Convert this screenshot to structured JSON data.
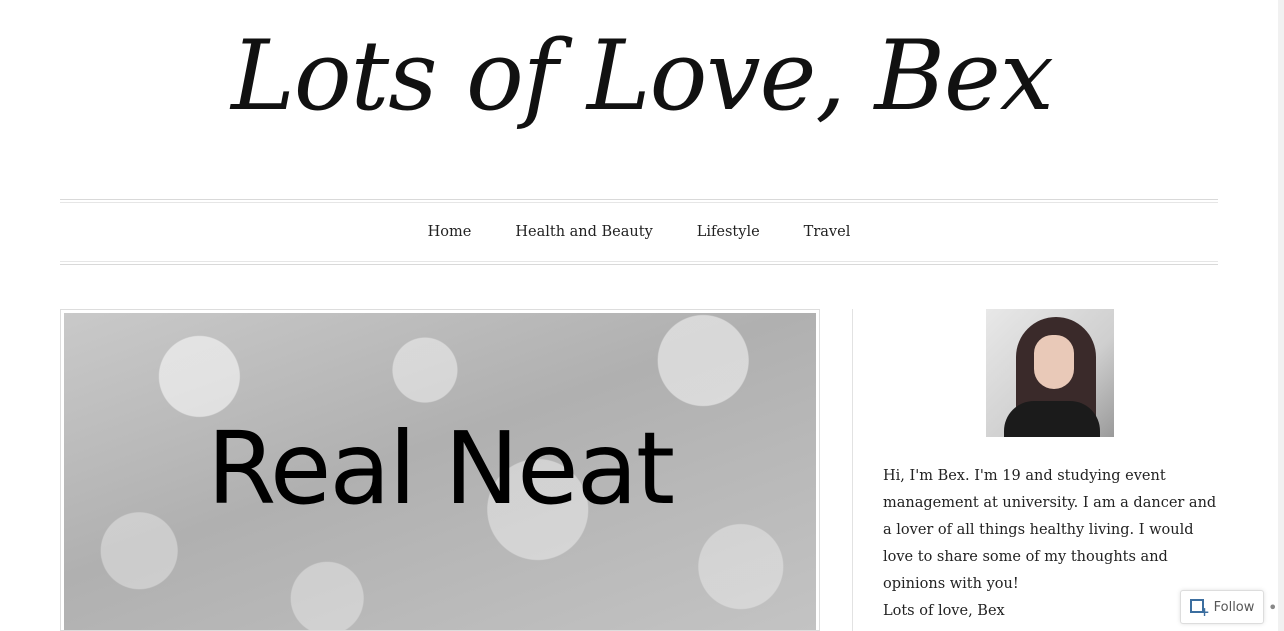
{
  "header": {
    "title": "Lots of Love, Bex"
  },
  "nav": {
    "items": [
      "Home",
      "Health and Beauty",
      "Lifestyle",
      "Travel"
    ]
  },
  "featured": {
    "headline": "Real Neat"
  },
  "sidebar": {
    "bio_lines": [
      "Hi, I'm Bex. I'm 19 and studying event management at university. I am a dancer and a lover of all things healthy living. I would love to share some of my thoughts and opinions with you!",
      "Lots of love, Bex"
    ]
  },
  "follow": {
    "label": "Follow",
    "more": "•••"
  }
}
